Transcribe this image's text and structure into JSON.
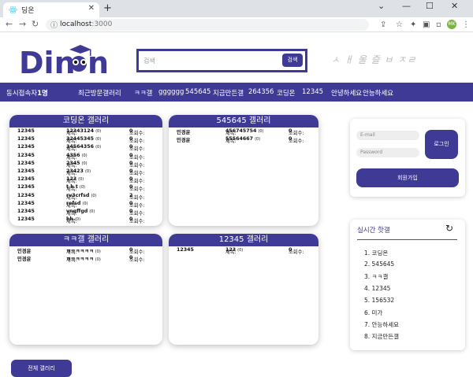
{
  "browser": {
    "tab_title": "딩온",
    "new_tab": "+",
    "url_host": "localhost",
    "url_port": ":3000"
  },
  "header": {
    "logo_text": "Dingon",
    "search_placeholder": "검색",
    "search_button": "검색",
    "slogan": "ㅅ ㅐ 울 즐 ㅂ ㅈㄹ"
  },
  "nav": {
    "visitors_label": "동시접속자",
    "visitors_count": "1명",
    "recent_label": "최근방문갤러리",
    "galleries": [
      "ㅋㅋ갤",
      "gggggg",
      "545645",
      "지금만든갤",
      "264356",
      "코딩온",
      "12345",
      "안녕하세요",
      "안능하세요"
    ]
  },
  "galleries": [
    {
      "title": "코딩온 갤러리",
      "posts": [
        {
          "author": "12345",
          "title": "12343124",
          "comments": "(0)",
          "views": "0"
        },
        {
          "author": "12345",
          "title": "32445345",
          "comments": "(0)",
          "views": "0"
        },
        {
          "author": "12345",
          "title": "34564356",
          "comments": "(0)",
          "views": "0"
        },
        {
          "author": "12345",
          "title": "4356",
          "comments": "(0)",
          "views": "0"
        },
        {
          "author": "12345",
          "title": "2345",
          "comments": "(0)",
          "views": "0"
        },
        {
          "author": "12345",
          "title": "23423",
          "comments": "(0)",
          "views": "0"
        },
        {
          "author": "12345",
          "title": "123",
          "comments": "(0)",
          "views": "0"
        },
        {
          "author": "12345",
          "title": "t h t",
          "comments": "(0)",
          "views": "0"
        },
        {
          "author": "12345",
          "title": "rv3crfsd",
          "comments": "(0)",
          "views": "2"
        },
        {
          "author": "12345",
          "title": "refsd",
          "comments": "(0)",
          "views": "0"
        },
        {
          "author": "12345",
          "title": "vngffgd",
          "comments": "(0)",
          "views": "0"
        },
        {
          "author": "12345",
          "title": "hh",
          "comments": "(0)",
          "views": "0"
        }
      ]
    },
    {
      "title": "545645 갤러리",
      "posts": [
        {
          "author": "민경윤",
          "title": "456745754",
          "comments": "(0)",
          "views": "0"
        },
        {
          "author": "민경윤",
          "title": "55564667",
          "comments": "(0)",
          "views": "0"
        }
      ]
    },
    {
      "title": "ㅋㅋ갤 갤러리",
      "posts": [
        {
          "author": "민경윤",
          "title": "ㅋㅋㅋㅋㅋㅋ",
          "comments": "(0)",
          "views": "0"
        },
        {
          "author": "민경윤",
          "title": "ㅋㅋㅋㅋㅋㅋ",
          "comments": "(0)",
          "views": "0"
        }
      ]
    },
    {
      "title": "12345 갤러리",
      "posts": [
        {
          "author": "12345",
          "title": "123",
          "comments": "(0)",
          "views": "0"
        }
      ]
    }
  ],
  "labels": {
    "title_prefix": "제목:",
    "views_prefix": "조회수:"
  },
  "login": {
    "email_placeholder": "E-mail",
    "password_placeholder": "Password",
    "login_button": "로그인",
    "join_button": "회원가입"
  },
  "hot": {
    "title": "실시간 핫갤",
    "items": [
      "1. 코딩온",
      "2. 545645",
      "3. ㅋㅋ갤",
      "4. 12345",
      "5. 156532",
      "6. 미가",
      "7. 안능하세요",
      "8. 지금만든갤"
    ]
  },
  "all_button": "전체 갤러리",
  "colors": {
    "accent": "#3f3a96"
  }
}
